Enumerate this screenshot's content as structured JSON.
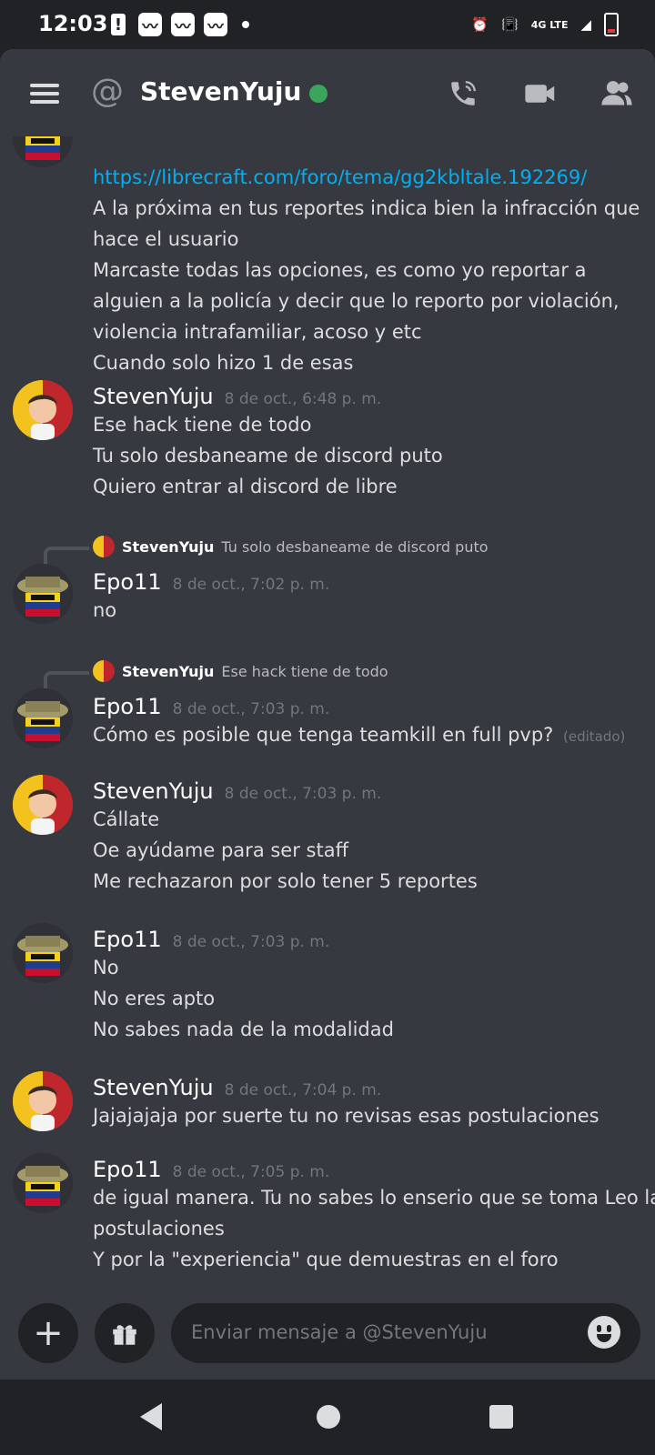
{
  "status_bar": {
    "time": "12:03",
    "left_icons": [
      "alert-icon",
      "notification-icon",
      "notification-icon",
      "notification-icon"
    ],
    "network": "4G LTE"
  },
  "header": {
    "at_symbol": "@",
    "title": "StevenYuju",
    "online_color": "#3ba55c"
  },
  "messages": [
    {
      "author": "Epo11",
      "lines": [
        "https://librecraft.com/foro/tema/gg2kbltale.192269/",
        "A la próxima en tus reportes indica bien la infracción que",
        "hace el usuario",
        "Marcaste todas las opciones, es como yo reportar a",
        "alguien a la policía y decir que lo reporto por violación,",
        "violencia intrafamiliar, acoso y etc",
        "Cuando solo hizo 1 de esas"
      ]
    },
    {
      "author": "StevenYuju",
      "timestamp": "8 de oct., 6:48 p. m.",
      "lines": [
        "Ese hack tiene de todo",
        "Tu solo desbaneame de discord puto",
        "Quiero entrar al discord de libre"
      ]
    },
    {
      "reply_author": "StevenYuju",
      "reply_text": "Tu solo desbaneame de discord puto",
      "author": "Epo11",
      "timestamp": "8 de oct., 7:02 p. m.",
      "lines": [
        "no"
      ]
    },
    {
      "reply_author": "StevenYuju",
      "reply_text": "Ese hack tiene de todo",
      "author": "Epo11",
      "timestamp": "8 de oct., 7:03 p. m.",
      "lines": [
        "Cómo es posible que tenga teamkill en full pvp?"
      ],
      "edited": "(editado)"
    },
    {
      "author": "StevenYuju",
      "timestamp": "8 de oct., 7:03 p. m.",
      "lines": [
        "Cállate",
        "Oe ayúdame para ser staff",
        "Me rechazaron por solo tener 5 reportes"
      ]
    },
    {
      "author": "Epo11",
      "timestamp": "8 de oct., 7:03 p. m.",
      "lines": [
        "No",
        "No eres apto",
        "No sabes nada de la modalidad"
      ]
    },
    {
      "author": "StevenYuju",
      "timestamp": "8 de oct., 7:04 p. m.",
      "lines": [
        "Jajajajaja por suerte tu no revisas esas postulaciones"
      ]
    },
    {
      "author": "Epo11",
      "timestamp": "8 de oct., 7:05 p. m.",
      "lines": [
        "de igual manera. Tu no sabes lo enserio que se toma Leo las",
        "postulaciones",
        "Y por la \"experiencia\" que demuestras en el foro"
      ]
    }
  ],
  "composer": {
    "placeholder": "Enviar mensaje a @StevenYuju",
    "plus_label": "+"
  },
  "colors": {
    "background": "#36393f",
    "dark": "#202225",
    "link": "#00aff4",
    "muted": "#72767d"
  }
}
